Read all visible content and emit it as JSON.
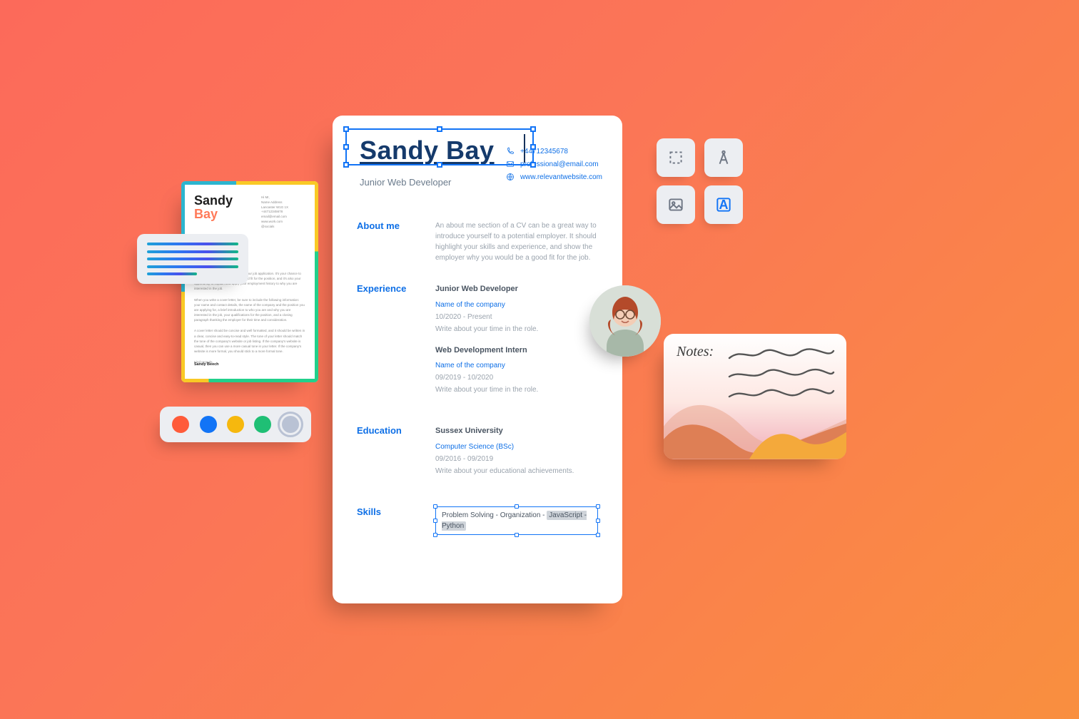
{
  "resume": {
    "name": "Sandy Bay",
    "role": "Junior Web Developer",
    "contact": {
      "phone": "+44712345678",
      "email": "professional@email.com",
      "website": "www.relevantwebsite.com"
    },
    "sections": {
      "about": {
        "label": "About me",
        "body": "An about me section of a CV can be a great way to introduce yourself to a potential employer. It should highlight your skills and experience, and show the employer why you would be a good fit for the job."
      },
      "experience": {
        "label": "Experience",
        "items": [
          {
            "title": "Junior Web Developer",
            "company": "Name of the company",
            "dates": "10/2020 - Present",
            "desc": "Write about your time in the role."
          },
          {
            "title": "Web Development Intern",
            "company": "Name of the company",
            "dates": "09/2019 - 10/2020",
            "desc": "Write about your time in the role."
          }
        ]
      },
      "education": {
        "label": "Education",
        "items": [
          {
            "title": "Sussex University",
            "company": "Computer Science (BSc)",
            "dates": "09/2016 - 09/2019",
            "desc": "Write about your educational achievements."
          }
        ]
      },
      "skills": {
        "label": "Skills",
        "text_plain": "Problem Solving - Organization - ",
        "text_highlight": "JavaScript - Python"
      }
    }
  },
  "cover_letter": {
    "first": "Sandy",
    "last": "Bay",
    "signature": "Sandy Beech",
    "meta": "Hi Mr,\nName Address\nLancaster W1G 1X\n+44712345678\nemail@email.com\nwww.work.com\n@socials",
    "body": [
      "A cover letter is an important part of your job application. It's your chance to show the employer that you are a good fit for the position, and it's also your opportunity to explain and apply your employment history to why you are interested in the job.",
      "When you write a cover letter, be sure to include the following information: your name and contact details, the name of the company and the position you are applying for, a brief introduction to who you are and why you are interested in the job, your qualifications for the position, and a closing paragraph thanking the employer for their time and consideration.",
      "A cover letter should be concise and well formatted, and it should be written in a clear, concise and easy-to-read style. The tone of your letter should match the tone of the company's website or job listing. If the company's website is casual, then you can use a more casual tone in your letter. If the company's website is more formal, you should stick to a more formal tone.",
      "Kind regards,"
    ]
  },
  "palette": {
    "colors": [
      "#ff5b3a",
      "#1274f6",
      "#f6b80e",
      "#1fbf75",
      "#b9c2d4"
    ],
    "selected_index": 4
  },
  "tools": {
    "items": [
      "bounding-box",
      "compass",
      "image",
      "text"
    ],
    "active": "text"
  },
  "notes": {
    "label": "Notes:"
  }
}
